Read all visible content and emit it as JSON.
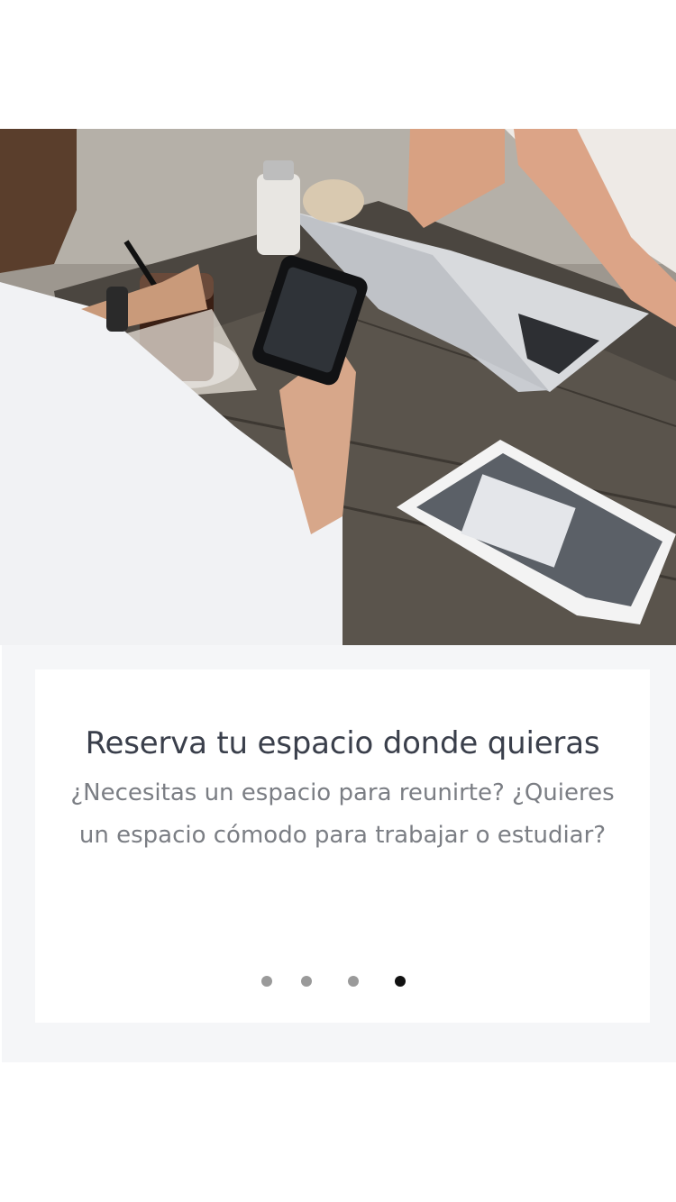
{
  "onboarding": {
    "title": "Reserva tu espacio donde quieras",
    "description": "¿Necesitas un espacio para reunirte? ¿Quieres un espacio cómodo para trabajar o estudiar?",
    "carousel": {
      "page_count": 4,
      "active_index": 3
    }
  },
  "colors": {
    "background": "#ffffff",
    "panel": "#f5f6f8",
    "title": "#3a3f4b",
    "text": "#7b7e84",
    "dot_inactive": "#9a9a9a",
    "dot_active": "#111111"
  }
}
